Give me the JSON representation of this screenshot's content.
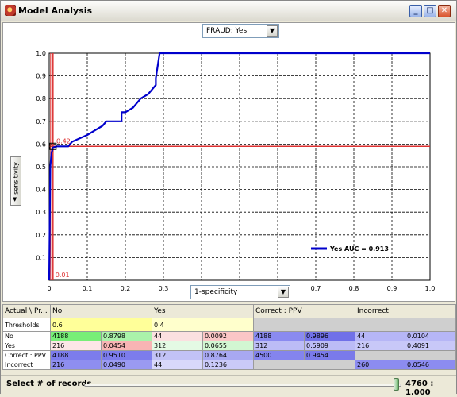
{
  "window": {
    "title": "Model Analysis",
    "minimize_label": "_",
    "maximize_label": "□",
    "close_label": "✕"
  },
  "target_select": {
    "value": "FRAUD:  Yes"
  },
  "y_axis_button": {
    "label": "sensitivity"
  },
  "x_axis_select": {
    "value": "1-specificity"
  },
  "chart_data": {
    "type": "line",
    "xlim": [
      0,
      1.0
    ],
    "ylim": [
      0,
      1.0
    ],
    "x_ticks": [
      "0",
      "0.1",
      "0.2",
      "0.3",
      "0.4",
      "0.5",
      "0.6",
      "0.7",
      "0.8",
      "0.9",
      "1.0"
    ],
    "y_ticks": [
      "0.1",
      "0.2",
      "0.3",
      "0.4",
      "0.5",
      "0.6",
      "0.7",
      "0.8",
      "0.9",
      "1.0"
    ],
    "grid": true,
    "legend_position": "bottom-right",
    "series": [
      {
        "name": "Yes AUC = 0.913",
        "color": "#0000cc",
        "points": [
          [
            0.0,
            0.0
          ],
          [
            0.003,
            0.5
          ],
          [
            0.006,
            0.56
          ],
          [
            0.01,
            0.585
          ],
          [
            0.02,
            0.59
          ],
          [
            0.05,
            0.59
          ],
          [
            0.06,
            0.61
          ],
          [
            0.08,
            0.625
          ],
          [
            0.1,
            0.64
          ],
          [
            0.12,
            0.66
          ],
          [
            0.14,
            0.68
          ],
          [
            0.15,
            0.7
          ],
          [
            0.19,
            0.7
          ],
          [
            0.19,
            0.74
          ],
          [
            0.2,
            0.74
          ],
          [
            0.22,
            0.76
          ],
          [
            0.24,
            0.8
          ],
          [
            0.26,
            0.82
          ],
          [
            0.27,
            0.84
          ],
          [
            0.28,
            0.86
          ],
          [
            0.28,
            0.89
          ],
          [
            0.29,
            1.0
          ],
          [
            1.0,
            1.0
          ]
        ]
      }
    ],
    "threshold_lines": [
      {
        "axis": "x",
        "value": 0.01,
        "label": "0.01",
        "color": "#dd3030"
      },
      {
        "axis": "y",
        "value": 0.59,
        "label": "0.42",
        "color": "#dd3030"
      }
    ],
    "threshold_point": [
      0.01,
      0.59
    ]
  },
  "table": {
    "headers": [
      "Actual \\ Pr...",
      "No",
      "Yes",
      "Correct : PPV",
      "Incorrect"
    ],
    "threshold_label": "Thresholds",
    "thresholds": [
      "0.6",
      "0.4"
    ],
    "rows": [
      {
        "label": "No",
        "cells": [
          [
            "4188",
            "0.8798"
          ],
          [
            "44",
            "0.0092"
          ],
          [
            "4188",
            "0.9896"
          ],
          [
            "44",
            "0.0104"
          ]
        ]
      },
      {
        "label": "Yes",
        "cells": [
          [
            "216",
            "0.0454"
          ],
          [
            "312",
            "0.0655"
          ],
          [
            "312",
            "0.5909"
          ],
          [
            "216",
            "0.4091"
          ]
        ]
      },
      {
        "label": "Correct : PPV",
        "cells": [
          [
            "4188",
            "0.9510"
          ],
          [
            "312",
            "0.8764"
          ],
          [
            "4500",
            "0.9454"
          ],
          [
            "",
            ""
          ]
        ]
      },
      {
        "label": "Incorrect",
        "cells": [
          [
            "216",
            "0.0490"
          ],
          [
            "44",
            "0.1236"
          ],
          [
            "",
            ""
          ],
          [
            "260",
            "0.0546"
          ]
        ]
      }
    ]
  },
  "status": {
    "label": "Select # of records",
    "ratio": "4760 : 1.000",
    "slider_fraction": 0.985
  }
}
